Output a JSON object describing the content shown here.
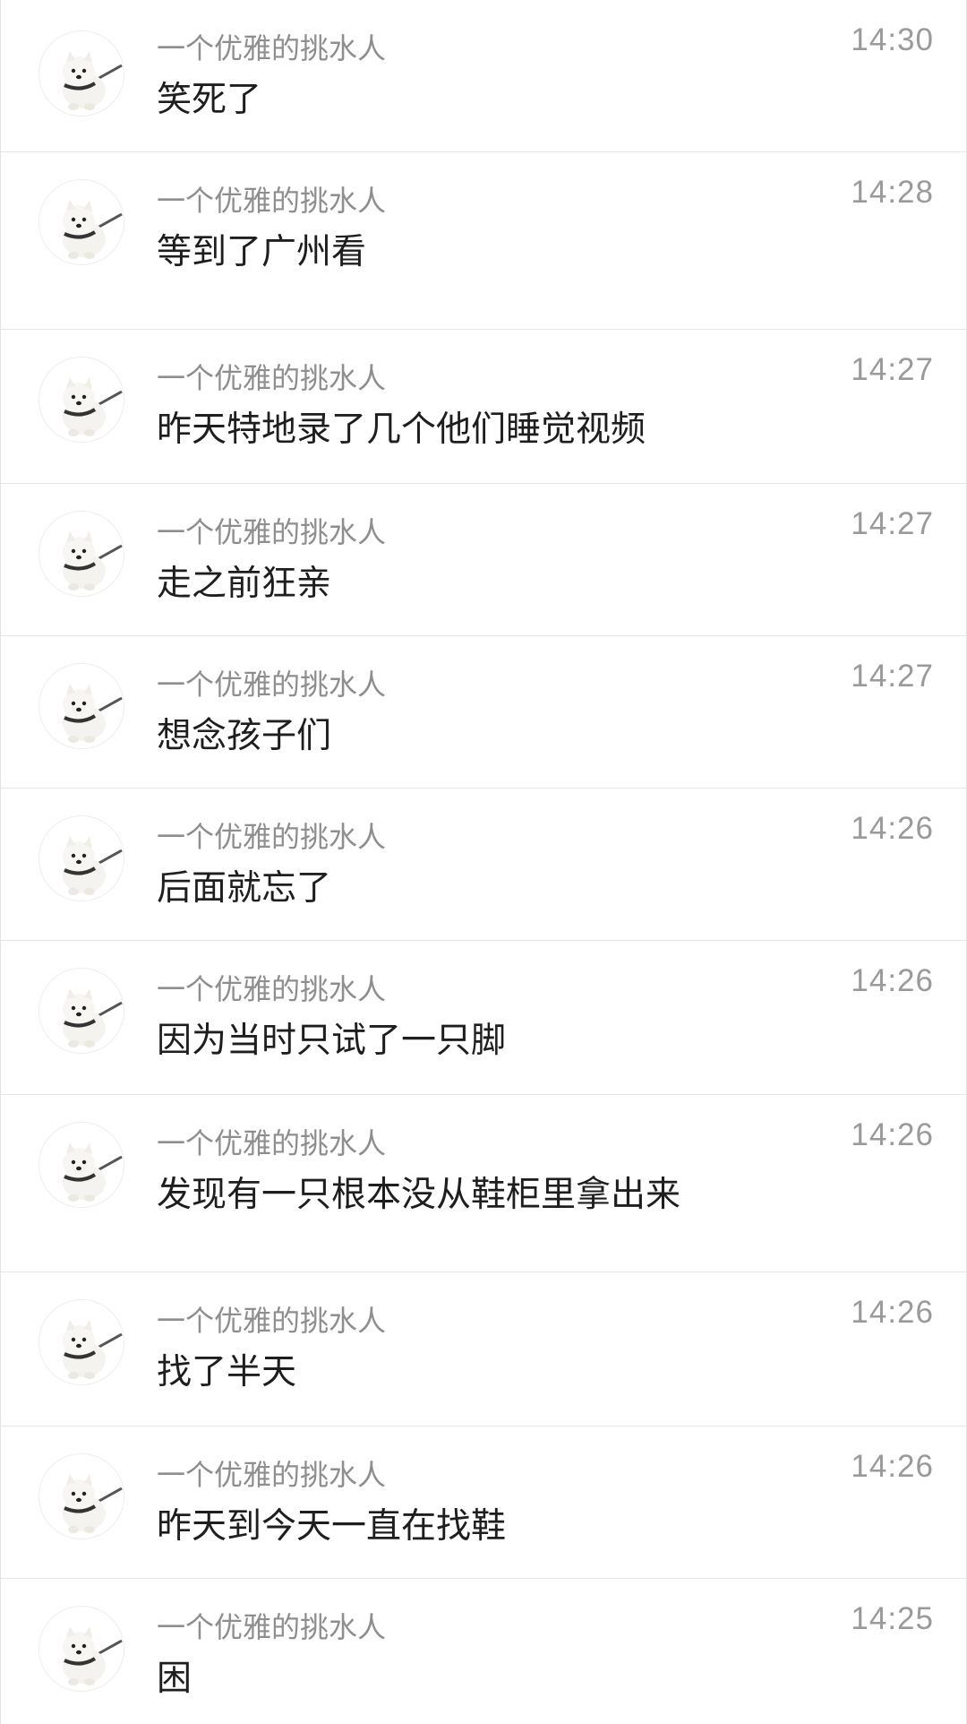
{
  "messages": [
    {
      "sender": "一个优雅的挑水人",
      "text": "笑死了",
      "time": "14:30",
      "avatar_icon": "samoyed-dog-avatar-icon"
    },
    {
      "sender": "一个优雅的挑水人",
      "text": "等到了广州看",
      "time": "14:28",
      "avatar_icon": "samoyed-dog-avatar-icon"
    },
    {
      "sender": "一个优雅的挑水人",
      "text": "昨天特地录了几个他们睡觉视频",
      "time": "14:27",
      "avatar_icon": "samoyed-dog-avatar-icon"
    },
    {
      "sender": "一个优雅的挑水人",
      "text": "走之前狂亲",
      "time": "14:27",
      "avatar_icon": "samoyed-dog-avatar-icon"
    },
    {
      "sender": "一个优雅的挑水人",
      "text": "想念孩子们",
      "time": "14:27",
      "avatar_icon": "samoyed-dog-avatar-icon"
    },
    {
      "sender": "一个优雅的挑水人",
      "text": "后面就忘了",
      "time": "14:26",
      "avatar_icon": "samoyed-dog-avatar-icon"
    },
    {
      "sender": "一个优雅的挑水人",
      "text": "因为当时只试了一只脚",
      "time": "14:26",
      "avatar_icon": "samoyed-dog-avatar-icon"
    },
    {
      "sender": "一个优雅的挑水人",
      "text": "发现有一只根本没从鞋柜里拿出来",
      "time": "14:26",
      "avatar_icon": "samoyed-dog-avatar-icon"
    },
    {
      "sender": "一个优雅的挑水人",
      "text": "找了半天",
      "time": "14:26",
      "avatar_icon": "samoyed-dog-avatar-icon"
    },
    {
      "sender": "一个优雅的挑水人",
      "text": "昨天到今天一直在找鞋",
      "time": "14:26",
      "avatar_icon": "samoyed-dog-avatar-icon"
    },
    {
      "sender": "一个优雅的挑水人",
      "text": "困",
      "time": "14:25",
      "avatar_icon": "samoyed-dog-avatar-icon"
    }
  ]
}
